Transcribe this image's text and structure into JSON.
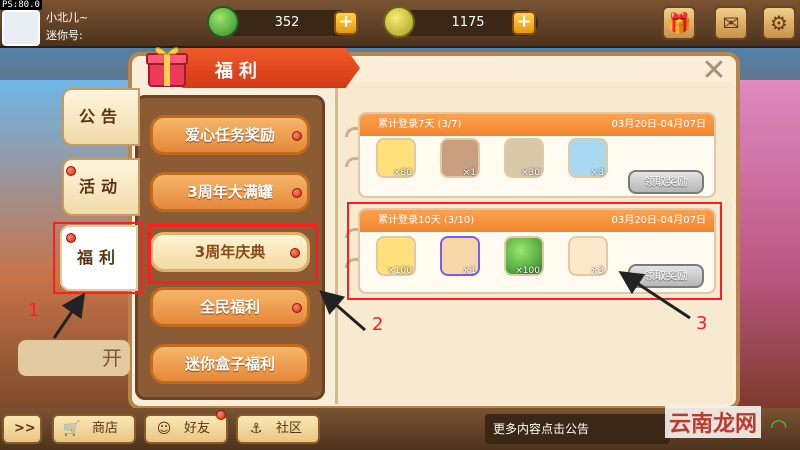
{
  "status": {
    "fps": "PS:80.0"
  },
  "player": {
    "name": "小北儿~",
    "id_label": "迷你号:"
  },
  "resources": {
    "gems": "352",
    "coins": "1175"
  },
  "icons": {
    "gem": "gem-icon",
    "coin": "coin-icon",
    "gift": "gift-icon",
    "mail": "mail-icon",
    "settings": "gear-icon"
  },
  "modal": {
    "title": "福利",
    "side_tabs": [
      {
        "label": "公告"
      },
      {
        "label": "活动"
      },
      {
        "label": "福利"
      }
    ],
    "menu": [
      {
        "label": "爱心任务奖励"
      },
      {
        "label": "3周年大满罐"
      },
      {
        "label": "3周年庆典"
      },
      {
        "label": "全民福利"
      },
      {
        "label": "迷你盒子福利"
      }
    ],
    "cards": [
      {
        "title": "累计登录7天 (3/7)",
        "date": "03月20日-04月07日",
        "items": [
          {
            "name": "ticket",
            "qty": "×80"
          },
          {
            "name": "hat",
            "qty": "×1"
          },
          {
            "name": "character",
            "qty": "×30"
          },
          {
            "name": "character",
            "qty": "×3"
          }
        ],
        "claim_label": "领取奖励"
      },
      {
        "title": "累计登录10天 (3/10)",
        "date": "03月20日-04月07日",
        "items": [
          {
            "name": "ticket",
            "qty": "×100"
          },
          {
            "name": "frame",
            "qty": "×1"
          },
          {
            "name": "gem",
            "qty": "×100"
          },
          {
            "name": "character",
            "qty": "×3"
          }
        ],
        "claim_label": "领取奖励"
      }
    ]
  },
  "annotations": {
    "one": "1",
    "two": "2",
    "three": "3"
  },
  "bottom": {
    "shop": "商店",
    "friends": "好友",
    "community": "社区",
    "notice": "更多内容点击公告",
    "expand": ">>",
    "left_tab_partial": "开"
  },
  "watermark": "云南龙网",
  "colors": {
    "accent": "#f2862c",
    "highlight": "#ff1d1d",
    "panel": "#8a5b35"
  }
}
